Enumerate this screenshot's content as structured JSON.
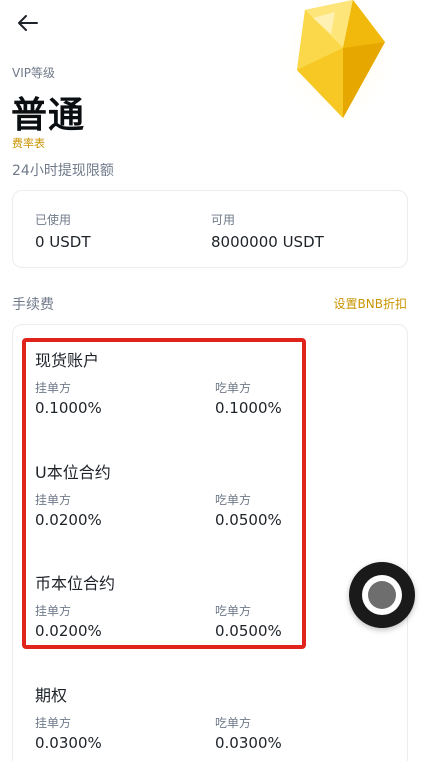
{
  "header": {
    "back_icon": "arrow-left-icon"
  },
  "vip": {
    "label": "VIP等级",
    "level": "普通",
    "fee_table_link": "费率表"
  },
  "withdraw_limit": {
    "title": "24小时提现限额",
    "used_label": "已使用",
    "used_value": "0 USDT",
    "available_label": "可用",
    "available_value": "8000000 USDT"
  },
  "fees": {
    "title": "手续费",
    "bnb_discount_link": "设置BNB折扣",
    "sections": [
      {
        "title": "现货账户",
        "maker_label": "挂单方",
        "maker": "0.1000%",
        "taker_label": "吃单方",
        "taker": "0.1000%"
      },
      {
        "title": "U本位合约",
        "maker_label": "挂单方",
        "maker": "0.0200%",
        "taker_label": "吃单方",
        "taker": "0.0500%"
      },
      {
        "title": "币本位合约",
        "maker_label": "挂单方",
        "maker": "0.0200%",
        "taker_label": "吃单方",
        "taker": "0.0500%"
      },
      {
        "title": "期权",
        "maker_label": "挂单方",
        "maker": "0.0300%",
        "taker_label": "吃单方",
        "taker": "0.0300%"
      }
    ]
  },
  "colors": {
    "accent": "#c99400",
    "highlight": "#e0231b",
    "gem": "#f0c30f"
  }
}
